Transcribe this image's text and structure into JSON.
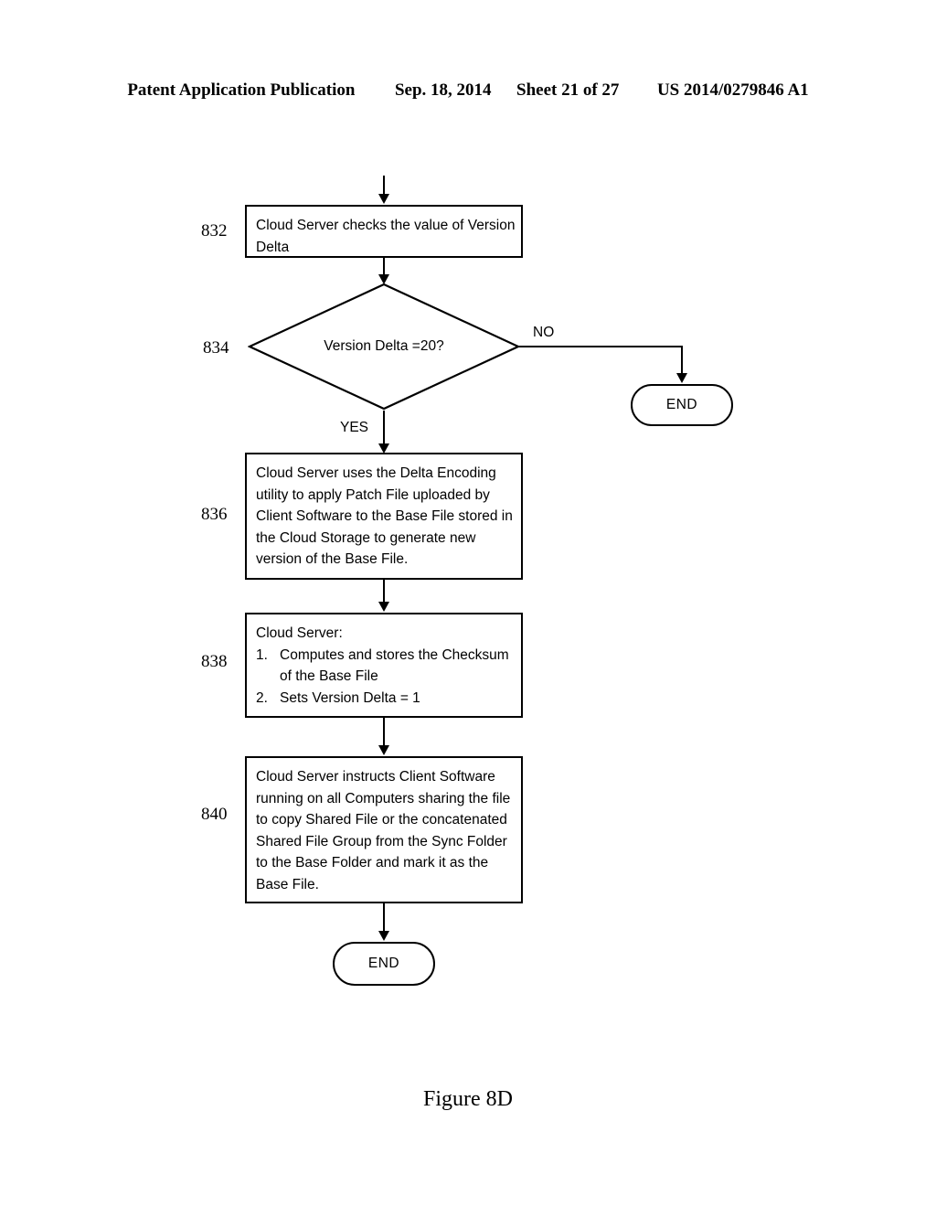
{
  "header": {
    "publication": "Patent Application Publication",
    "date": "Sep. 18, 2014",
    "sheet": "Sheet 21 of 27",
    "patent_number": "US 2014/0279846 A1"
  },
  "figure": {
    "caption": "Figure 8D"
  },
  "flowchart": {
    "entry_arrow": "arrow-down",
    "nodes": {
      "n832": {
        "ref": "832",
        "type": "process",
        "lines": [
          "Cloud Server checks the value of Version",
          "Delta"
        ]
      },
      "n834": {
        "ref": "834",
        "type": "decision",
        "label": "Version Delta =20?",
        "branch_yes": "YES",
        "branch_no": "NO"
      },
      "n836": {
        "ref": "836",
        "type": "process",
        "lines": [
          "Cloud Server uses the Delta Encoding",
          "utility to apply Patch File uploaded by",
          "Client Software to the Base File stored in",
          "the Cloud Storage to generate new",
          "version of the Base File."
        ]
      },
      "n838": {
        "ref": "838",
        "type": "process",
        "heading": "Cloud Server:",
        "items": [
          {
            "num": "1.",
            "lines": [
              "Computes and stores the Checksum",
              "of the Base File"
            ]
          },
          {
            "num": "2.",
            "lines": [
              "Sets Version Delta = 1"
            ]
          }
        ]
      },
      "n840": {
        "ref": "840",
        "type": "process",
        "lines": [
          "Cloud Server instructs Client Software",
          "running on all Computers sharing the file",
          "to copy Shared File or the concatenated",
          "Shared File Group from the Sync Folder",
          "to the Base Folder and mark it as the",
          "Base File."
        ]
      },
      "end_no": {
        "type": "terminator",
        "label": "END"
      },
      "end_yes": {
        "type": "terminator",
        "label": "END"
      }
    }
  },
  "colors": {
    "line": "#000000",
    "background": "#ffffff"
  }
}
